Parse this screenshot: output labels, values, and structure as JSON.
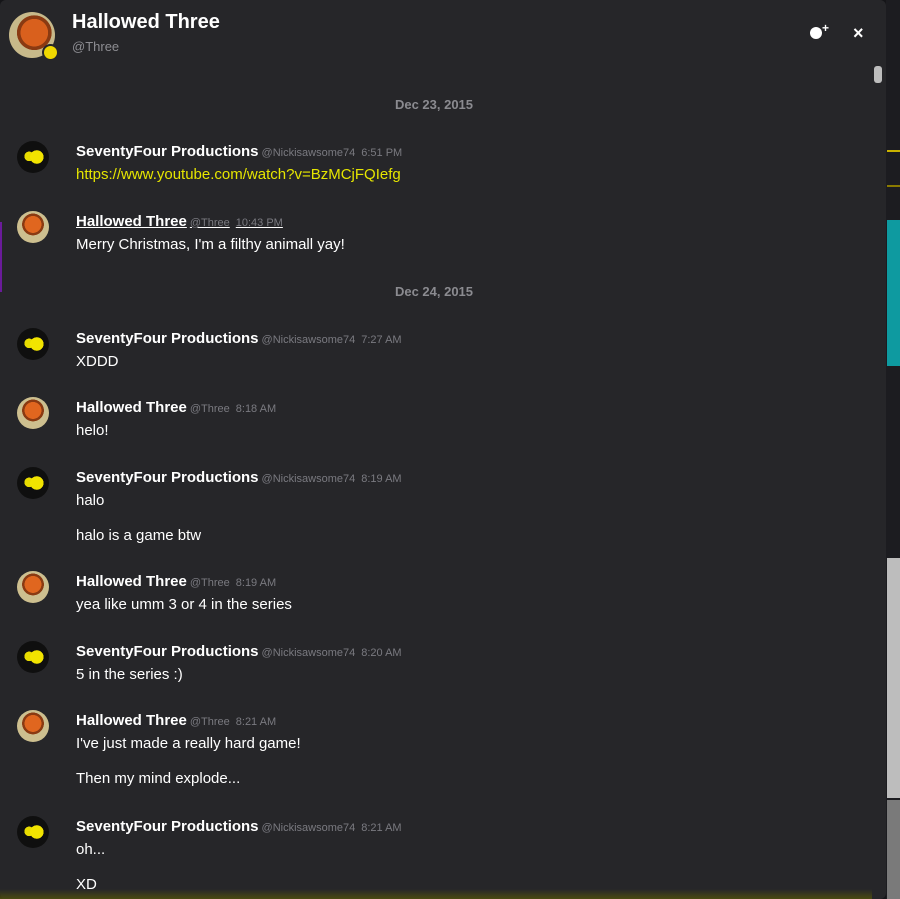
{
  "header": {
    "name": "Hallowed Three",
    "handle": "@Three",
    "close_label": "×"
  },
  "colors": {
    "accent": "#f0d800",
    "panel": "#262629",
    "link": "#e6e600"
  },
  "icons": {
    "add_friend": "add-friend-icon",
    "close": "close-icon"
  },
  "dates": [
    "Dec 23, 2015",
    "Dec 24, 2015"
  ],
  "messages": [
    {
      "author": "SeventyFour Productions",
      "handle": "@Nickisawsome74",
      "time": "6:51 PM",
      "lines": [
        "https://www.youtube.com/watch?v=BzMCjFQIefg"
      ]
    },
    {
      "author": "Hallowed Three",
      "handle": "@Three",
      "time": "10:43 PM",
      "lines": [
        "Merry Christmas, I'm a filthy animall yay!"
      ]
    },
    {
      "author": "SeventyFour Productions",
      "handle": "@Nickisawsome74",
      "time": "7:27 AM",
      "lines": [
        "XDDD"
      ]
    },
    {
      "author": "Hallowed Three",
      "handle": "@Three",
      "time": "8:18 AM",
      "lines": [
        "helo!"
      ]
    },
    {
      "author": "SeventyFour Productions",
      "handle": "@Nickisawsome74",
      "time": "8:19 AM",
      "lines": [
        "halo",
        "halo is a game btw"
      ]
    },
    {
      "author": "Hallowed Three",
      "handle": "@Three",
      "time": "8:19 AM",
      "lines": [
        "yea like umm 3 or 4 in the series"
      ]
    },
    {
      "author": "SeventyFour Productions",
      "handle": "@Nickisawsome74",
      "time": "8:20 AM",
      "lines": [
        "5 in the series :)"
      ]
    },
    {
      "author": "Hallowed Three",
      "handle": "@Three",
      "time": "8:21 AM",
      "lines": [
        "I've just made a really hard game!",
        "Then my mind explode..."
      ]
    },
    {
      "author": "SeventyFour Productions",
      "handle": "@Nickisawsome74",
      "time": "8:21 AM",
      "lines": [
        "oh...",
        "XD"
      ]
    }
  ]
}
